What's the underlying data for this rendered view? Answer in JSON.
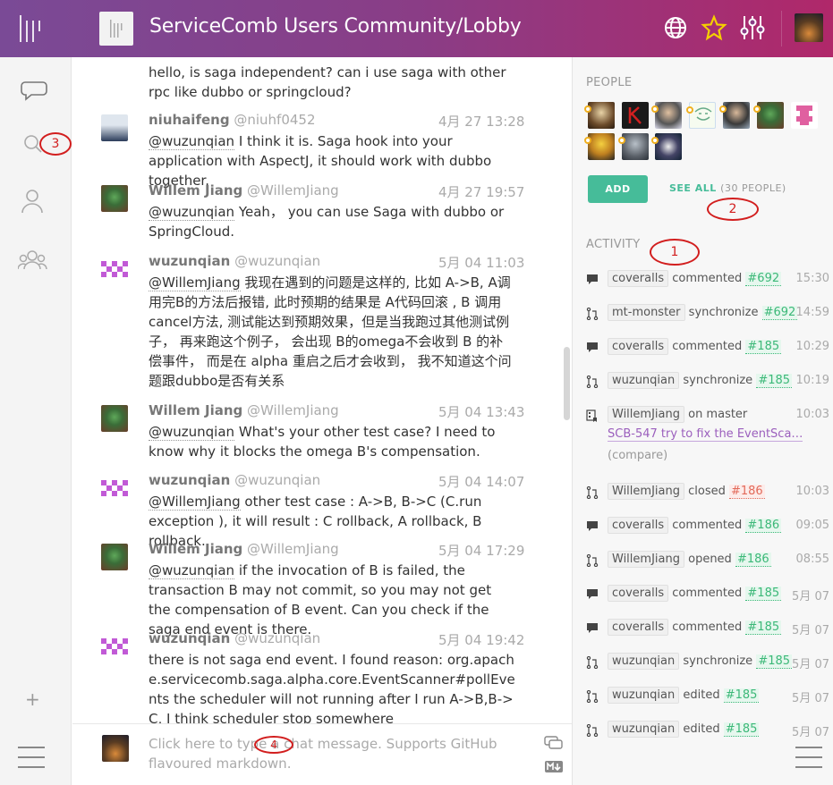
{
  "header": {
    "title": "ServiceComb Users Community/Lobby",
    "icons": [
      "globe-icon",
      "star-icon",
      "settings-sliders-icon"
    ]
  },
  "leftrail": {
    "icons": [
      "chat-icon",
      "search-icon",
      "user-icon",
      "community-icon",
      "plus-icon",
      "menu-icon"
    ],
    "plus_label": "+"
  },
  "chat": {
    "partial_top": {
      "text": "hello, is saga independent? can i use saga with other rpc like dubbo or springcloud?"
    },
    "messages": [
      {
        "name": "niuhaifeng",
        "username": "@niuhf0452",
        "time": "4月 27 13:28",
        "mention": "@wuzunqian",
        "text": " I think it is. Saga hook into your application with AspectJ, it should work with dubbo together."
      },
      {
        "name": "Willem Jiang",
        "username": "@WillemJiang",
        "time": "4月 27 19:57",
        "mention": "@wuzunqian",
        "text": " Yeah，  you can use Saga with dubbo or SpringCloud."
      },
      {
        "name": "wuzunqian",
        "username": "@wuzunqian",
        "time": "5月 04 11:03",
        "mention": "@WillemJiang",
        "text": " 我现在遇到的问题是这样的, 比如 A->B, A调用完B的方法后报错, 此时预期的结果是 A代码回滚 , B 调用cancel方法, 测试能达到预期效果，但是当我跑过其他测试例子， 再来跑这个例子， 会出现 B的omega不会收到 B 的补偿事件， 而是在 alpha 重启之后才会收到， 我不知道这个问题跟dubbo是否有关系"
      },
      {
        "name": "Willem Jiang",
        "username": "@WillemJiang",
        "time": "5月 04 13:43",
        "mention": "@wuzunqian",
        "text": " What's your other test case? I need to know why it blocks the omega B's compensation."
      },
      {
        "name": "wuzunqian",
        "username": "@wuzunqian",
        "time": "5月 04 14:07",
        "mention": "@WillemJiang",
        "text": " other test case : A->B, B->C (C.run exception ), it will result : C rollback, A rollback, B rollback."
      },
      {
        "name": "Willem Jiang",
        "username": "@WillemJiang",
        "time": "5月 04 17:29",
        "mention": "@wuzunqian",
        "text": " if the invocation of B is failed, the transaction B may not commit, so you may not get the compensation of B event. Can you check if the saga end event is there."
      },
      {
        "name": "wuzunqian",
        "username": "@wuzunqian",
        "time": "5月 04 19:42",
        "mention": "",
        "text": "there is not saga end event. I found reason: org.apache.servicecomb.saga.alpha.core.EventScanner#pollEvents the scheduler will not running after I run A->B,B->C, I think scheduler stop somewhere"
      }
    ]
  },
  "input": {
    "placeholder": "Click here to type a chat message. Supports GitHub flavoured markdown."
  },
  "people": {
    "label": "PEOPLE",
    "add_label": "ADD",
    "see_all_label": "SEE ALL",
    "see_all_count": "(30 PEOPLE)"
  },
  "activity": {
    "label": "ACTIVITY",
    "items": [
      {
        "icon": "comment-icon",
        "who": "coveralls",
        "action": "commented",
        "pr": "#692",
        "time": "15:30"
      },
      {
        "icon": "pull-request-icon",
        "who": "mt-monster",
        "action": "synchronize",
        "pr": "#692",
        "time": "14:59"
      },
      {
        "icon": "comment-icon",
        "who": "coveralls",
        "action": "commented",
        "pr": "#185",
        "time": "10:29"
      },
      {
        "icon": "pull-request-icon",
        "who": "wuzunqian",
        "action": "synchronize",
        "pr": "#185",
        "time": "10:19"
      },
      {
        "icon": "commit-icon",
        "who": "WillemJiang",
        "action": "on master",
        "pr": "",
        "time": "10:03",
        "link": "SCB-547 try to fix the EventSca…",
        "extra": "(compare)"
      },
      {
        "icon": "pull-request-icon",
        "who": "WillemJiang",
        "action": "closed",
        "pr": "#186",
        "time": "10:03",
        "red": true
      },
      {
        "icon": "comment-icon",
        "who": "coveralls",
        "action": "commented",
        "pr": "#186",
        "time": "09:05"
      },
      {
        "icon": "pull-request-icon",
        "who": "WillemJiang",
        "action": "opened",
        "pr": "#186",
        "time": "08:55"
      },
      {
        "icon": "comment-icon",
        "who": "coveralls",
        "action": "commented",
        "pr": "#185",
        "time": "5月 07"
      },
      {
        "icon": "comment-icon",
        "who": "coveralls",
        "action": "commented",
        "pr": "#185",
        "time": "5月 07"
      },
      {
        "icon": "pull-request-icon",
        "who": "wuzunqian",
        "action": "synchronize",
        "pr": "#185",
        "time": "5月 07"
      },
      {
        "icon": "pull-request-icon",
        "who": "wuzunqian",
        "action": "edited",
        "pr": "#185",
        "time": "5月 07"
      },
      {
        "icon": "pull-request-icon",
        "who": "wuzunqian",
        "action": "edited",
        "pr": "#185",
        "time": "5月 07"
      }
    ]
  },
  "annotations": [
    "1",
    "2",
    "3",
    "4"
  ],
  "colors": {
    "header_start": "#7a4a96",
    "header_end": "#b0286a",
    "accent_green": "#46bc99",
    "annotation_red": "#d21e1e"
  }
}
